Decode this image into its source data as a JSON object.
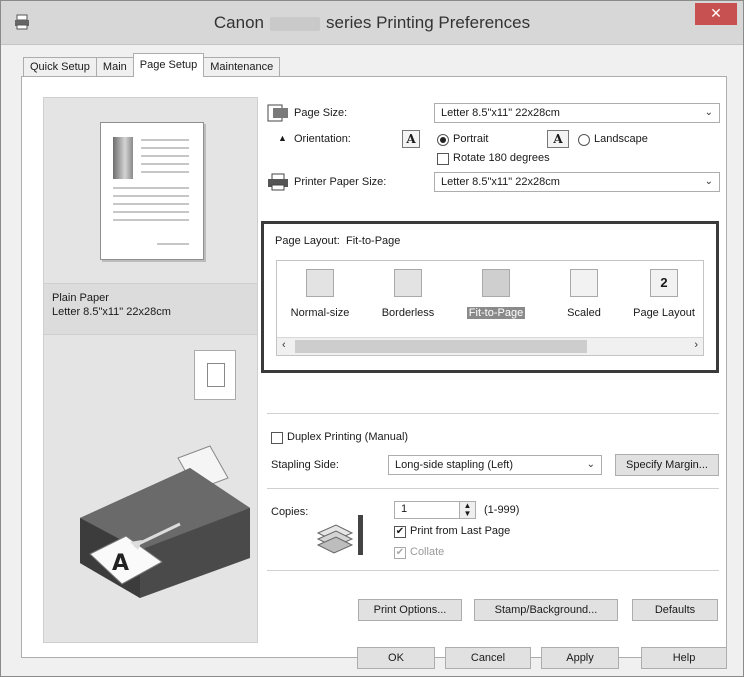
{
  "window": {
    "title_left": "Canon",
    "title_right": "series Printing Preferences",
    "close_glyph": "✕"
  },
  "tabs": [
    {
      "label": "Quick Setup"
    },
    {
      "label": "Main"
    },
    {
      "label": "Page Setup"
    },
    {
      "label": "Maintenance"
    }
  ],
  "preview": {
    "media_type": "Plain Paper",
    "media_size": "Letter 8.5\"x11\" 22x28cm"
  },
  "page_size": {
    "label": "Page Size:",
    "value": "Letter 8.5\"x11\" 22x28cm"
  },
  "orientation": {
    "label": "Orientation:",
    "portrait_label": "Portrait",
    "landscape_label": "Landscape",
    "portrait_icon_glyph": "A",
    "landscape_icon_glyph": "A",
    "rotate_label": "Rotate 180 degrees"
  },
  "printer_paper_size": {
    "label": "Printer Paper Size:",
    "value": "Letter 8.5\"x11\" 22x28cm"
  },
  "page_layout": {
    "label": "Page Layout:",
    "current": "Fit-to-Page",
    "items": [
      {
        "label": "Normal-size",
        "glyph": ""
      },
      {
        "label": "Borderless",
        "glyph": ""
      },
      {
        "label": "Fit-to-Page",
        "glyph": ""
      },
      {
        "label": "Scaled",
        "glyph": ""
      },
      {
        "label": "Page Layout",
        "glyph": "2"
      }
    ],
    "scroll_left": "‹",
    "scroll_right": "›"
  },
  "duplex": {
    "label": "Duplex Printing (Manual)"
  },
  "stapling": {
    "label": "Stapling Side:",
    "value": "Long-side stapling (Left)",
    "specify_margin": "Specify Margin..."
  },
  "copies": {
    "label": "Copies:",
    "value": "1",
    "range": "(1-999)",
    "print_last_label": "Print from Last Page",
    "print_last_mark": "✔",
    "collate_label": "Collate",
    "collate_mark": "✔"
  },
  "bottom_buttons": {
    "print_options": "Print Options...",
    "stamp_background": "Stamp/Background...",
    "defaults": "Defaults"
  },
  "dialog_buttons": {
    "ok": "OK",
    "cancel": "Cancel",
    "apply": "Apply",
    "help": "Help"
  },
  "dropdown_glyph": "⌄",
  "colors": {
    "titlebar": "#d7d7d7",
    "close": "#c75050",
    "highlight_border": "#3a3a3a"
  }
}
